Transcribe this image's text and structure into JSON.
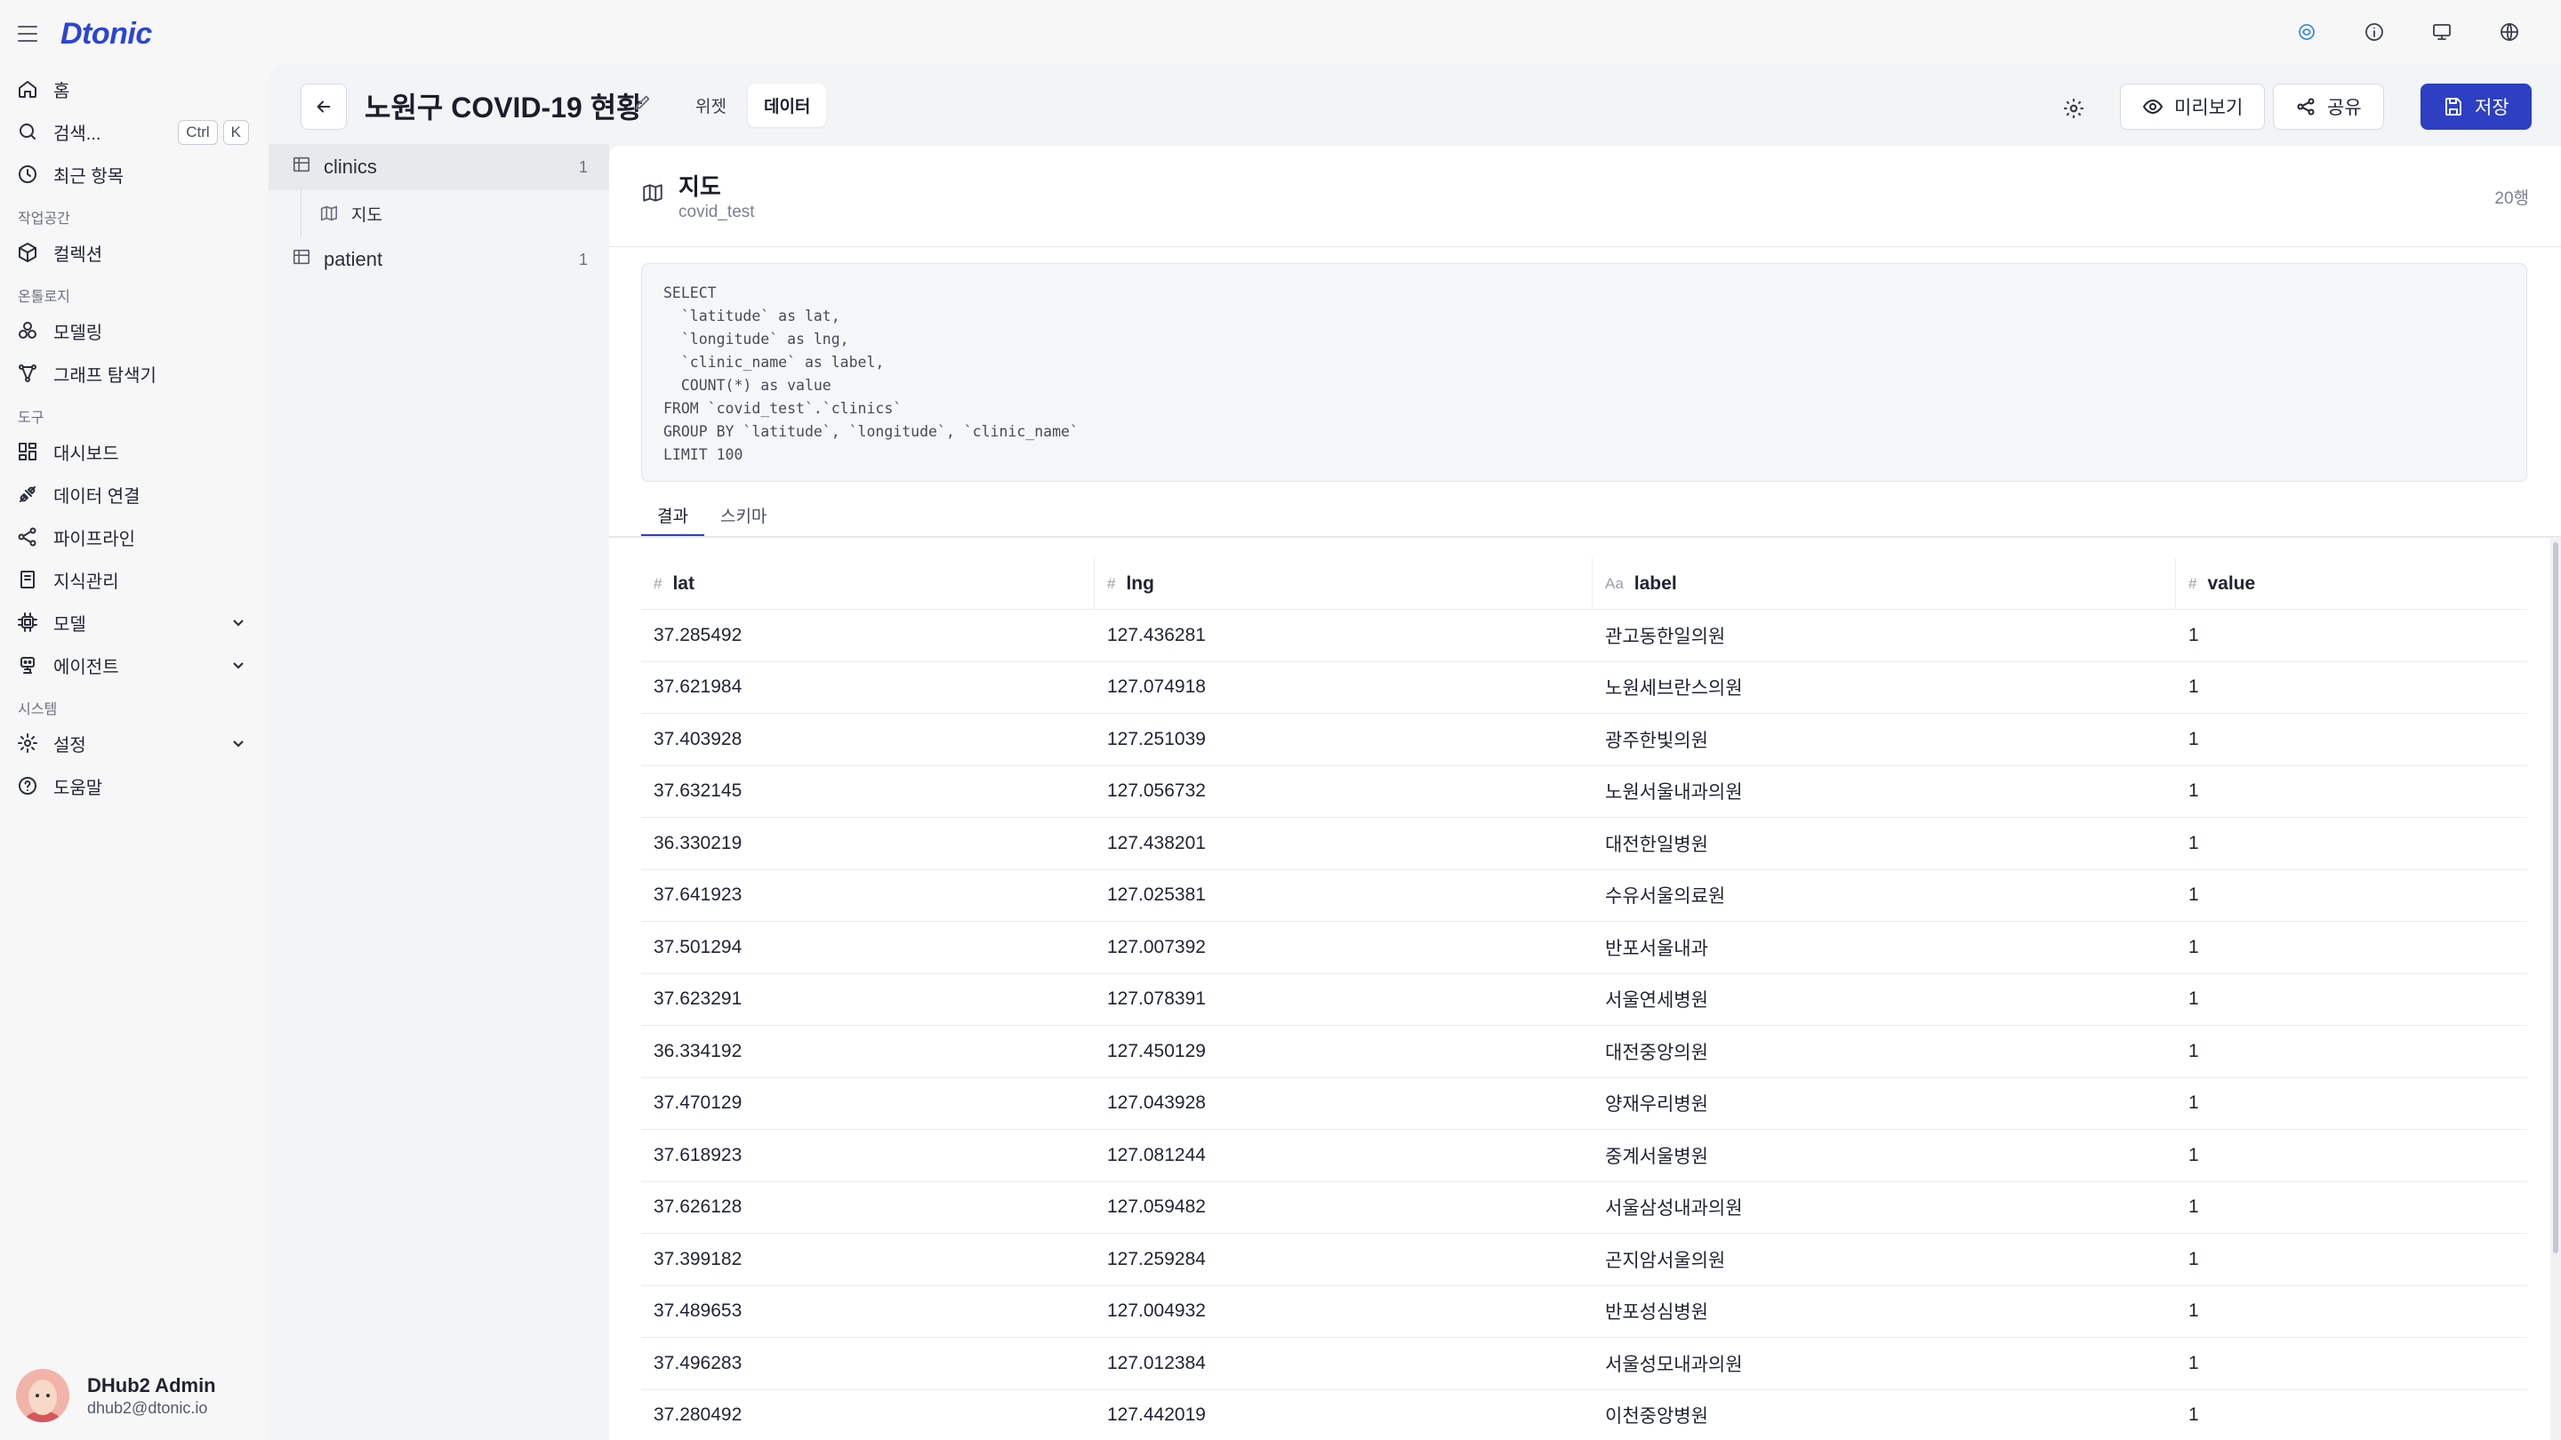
{
  "app": {
    "logo": "Dtonic"
  },
  "nav": {
    "home": "홈",
    "search": "검색...",
    "search_kbd": [
      "Ctrl",
      "K"
    ],
    "recent": "최근 항목",
    "sections": {
      "workspace": "작업공간",
      "ontology": "온톨로지",
      "tools": "도구",
      "system": "시스템"
    },
    "collection": "컬렉션",
    "modeling": "모델링",
    "graph_explorer": "그래프 탐색기",
    "dashboard": "대시보드",
    "data_connection": "데이터 연결",
    "pipeline": "파이프라인",
    "knowledge": "지식관리",
    "model": "모델",
    "agent": "에이전트",
    "settings": "설정",
    "help": "도움말"
  },
  "user": {
    "name": "DHub2 Admin",
    "email": "dhub2@dtonic.io"
  },
  "header": {
    "title": "노원구 COVID-19 현황",
    "tabs": [
      "위젯",
      "데이터"
    ],
    "active_tab": "데이터",
    "preview": "미리보기",
    "share": "공유",
    "save": "저장"
  },
  "sources": [
    {
      "name": "clinics",
      "count": "1",
      "children": [
        "지도"
      ]
    },
    {
      "name": "patient",
      "count": "1"
    }
  ],
  "dataset": {
    "title": "지도",
    "subtitle": "covid_test",
    "rows": "20행",
    "sql": "SELECT\n  `latitude` as lat,\n  `longitude` as lng,\n  `clinic_name` as label,\n  COUNT(*) as value\nFROM `covid_test`.`clinics`\nGROUP BY `latitude`, `longitude`, `clinic_name`\nLIMIT 100"
  },
  "result_tabs": [
    "결과",
    "스키마"
  ],
  "table": {
    "columns": [
      {
        "type": "#",
        "name": "lat"
      },
      {
        "type": "#",
        "name": "lng"
      },
      {
        "type": "Aa",
        "name": "label"
      },
      {
        "type": "#",
        "name": "value"
      }
    ],
    "rows": [
      [
        "37.285492",
        "127.436281",
        "관고동한일의원",
        "1"
      ],
      [
        "37.621984",
        "127.074918",
        "노원세브란스의원",
        "1"
      ],
      [
        "37.403928",
        "127.251039",
        "광주한빛의원",
        "1"
      ],
      [
        "37.632145",
        "127.056732",
        "노원서울내과의원",
        "1"
      ],
      [
        "36.330219",
        "127.438201",
        "대전한일병원",
        "1"
      ],
      [
        "37.641923",
        "127.025381",
        "수유서울의료원",
        "1"
      ],
      [
        "37.501294",
        "127.007392",
        "반포서울내과",
        "1"
      ],
      [
        "37.623291",
        "127.078391",
        "서울연세병원",
        "1"
      ],
      [
        "36.334192",
        "127.450129",
        "대전중앙의원",
        "1"
      ],
      [
        "37.470129",
        "127.043928",
        "양재우리병원",
        "1"
      ],
      [
        "37.618923",
        "127.081244",
        "중계서울병원",
        "1"
      ],
      [
        "37.626128",
        "127.059482",
        "서울삼성내과의원",
        "1"
      ],
      [
        "37.399182",
        "127.259284",
        "곤지암서울의원",
        "1"
      ],
      [
        "37.489653",
        "127.004932",
        "반포성심병원",
        "1"
      ],
      [
        "37.496283",
        "127.012384",
        "서울성모내과의원",
        "1"
      ],
      [
        "37.280492",
        "127.442019",
        "이천중앙병원",
        "1"
      ]
    ]
  }
}
